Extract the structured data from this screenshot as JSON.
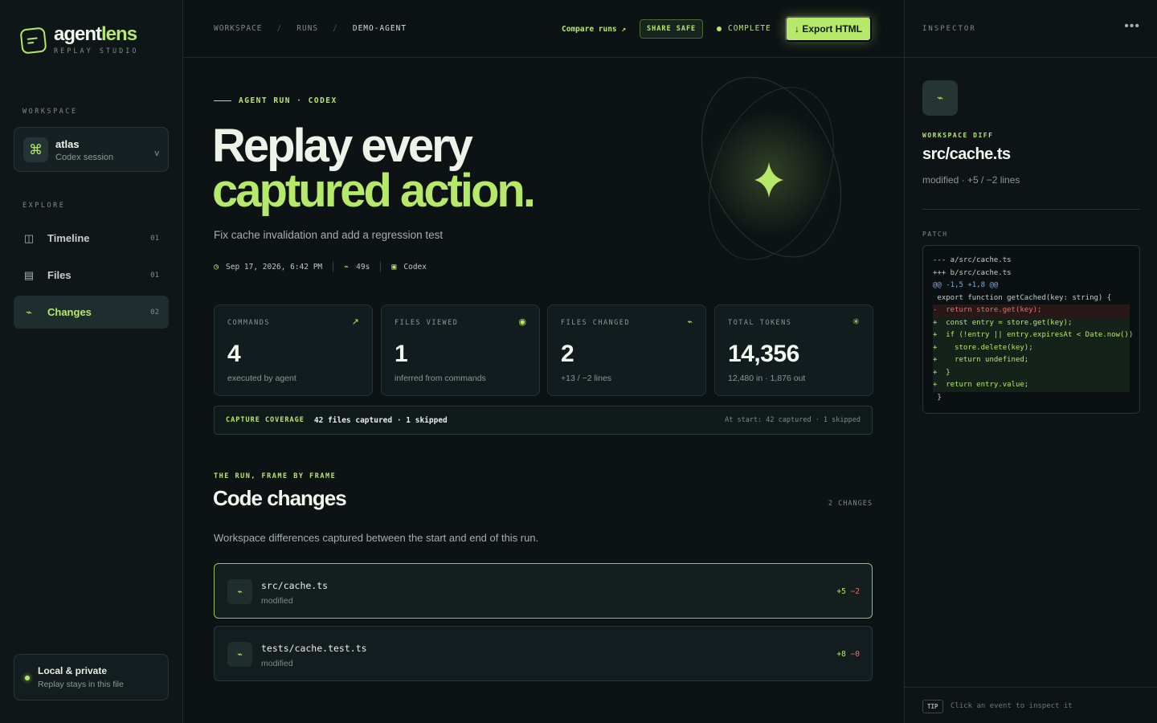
{
  "brand": {
    "name_main": "agent",
    "name_accent": "lens",
    "subtitle": "REPLAY STUDIO",
    "accent_color": "#b6e86a"
  },
  "sidebar": {
    "workspace_label": "WORKSPACE",
    "workspace": {
      "name": "atlas",
      "sub": "Codex session",
      "caret": "v",
      "icon": "command-icon"
    },
    "explore_label": "EXPLORE",
    "items": [
      {
        "label": "Timeline",
        "count": "01",
        "icon": "columns-icon"
      },
      {
        "label": "Files",
        "count": "01",
        "icon": "file-list-icon"
      },
      {
        "label": "Changes",
        "count": "02",
        "icon": "diff-icon",
        "active": true
      }
    ],
    "private": {
      "title": "Local & private",
      "sub": "Replay stays in this file"
    }
  },
  "topbar": {
    "breadcrumbs": [
      "WORKSPACE",
      "RUNS",
      "DEMO-AGENT"
    ],
    "separator": "/",
    "compare_label": "Compare runs ↗",
    "share_label": "SHARE SAFE",
    "status_label": "COMPLETE",
    "export_label": "↓ Export HTML"
  },
  "hero": {
    "eyebrow": "AGENT RUN · CODEX",
    "title_line1": "Replay every",
    "title_line2": "captured action.",
    "subtitle": "Fix cache invalidation and add a regression test",
    "meta": {
      "date": "Sep 17, 2026, 6:42 PM",
      "duration": "49s",
      "agent": "Codex"
    }
  },
  "stats": [
    {
      "label": "COMMANDS",
      "value": "4",
      "sub": "executed by agent",
      "icon": "arrow-up-right-icon"
    },
    {
      "label": "FILES VIEWED",
      "value": "1",
      "sub": "inferred from commands",
      "icon": "eye-icon"
    },
    {
      "label": "FILES CHANGED",
      "value": "2",
      "sub": "+13 / −2 lines",
      "icon": "diff-icon"
    },
    {
      "label": "TOTAL TOKENS",
      "value": "14,356",
      "sub": "12,480 in · 1,876 out",
      "icon": "asterisk-icon"
    }
  ],
  "coverage": {
    "label": "CAPTURE COVERAGE",
    "value": "42 files captured · 1 skipped",
    "right": "At start: 42 captured · 1 skipped"
  },
  "section": {
    "eyebrow": "THE RUN, FRAME BY FRAME",
    "title": "Code changes",
    "count": "2 CHANGES",
    "description": "Workspace differences captured between the start and end of this run."
  },
  "changes": [
    {
      "path": "src/cache.ts",
      "status": "modified",
      "added": "+5",
      "removed": "−2",
      "selected": true
    },
    {
      "path": "tests/cache.test.ts",
      "status": "modified",
      "added": "+8",
      "removed": "−0",
      "selected": false
    }
  ],
  "inspector": {
    "label": "INSPECTOR",
    "more": "•••",
    "kind": "WORKSPACE DIFF",
    "title": "src/cache.ts",
    "sub": "modified · +5 / −2 lines",
    "patch_label": "PATCH",
    "patch_lines": [
      {
        "type": "meta",
        "text": "--- a/src/cache.ts"
      },
      {
        "type": "meta",
        "text": "+++ b/src/cache.ts"
      },
      {
        "type": "hunk",
        "text": "@@ -1,5 +1,8 @@"
      },
      {
        "type": "ctx",
        "text": " export function getCached(key: string) {"
      },
      {
        "type": "minus",
        "text": "-  return store.get(key);"
      },
      {
        "type": "plus",
        "text": "+  const entry = store.get(key);"
      },
      {
        "type": "plus",
        "text": "+  if (!entry || entry.expiresAt < Date.now())"
      },
      {
        "type": "plus",
        "text": "+    store.delete(key);"
      },
      {
        "type": "plus",
        "text": "+    return undefined;"
      },
      {
        "type": "plus",
        "text": "+  }"
      },
      {
        "type": "plus",
        "text": "+  return entry.value;"
      },
      {
        "type": "ctx",
        "text": " }"
      }
    ],
    "tip_badge": "TIP",
    "tip_text": "Click an event to inspect it"
  }
}
